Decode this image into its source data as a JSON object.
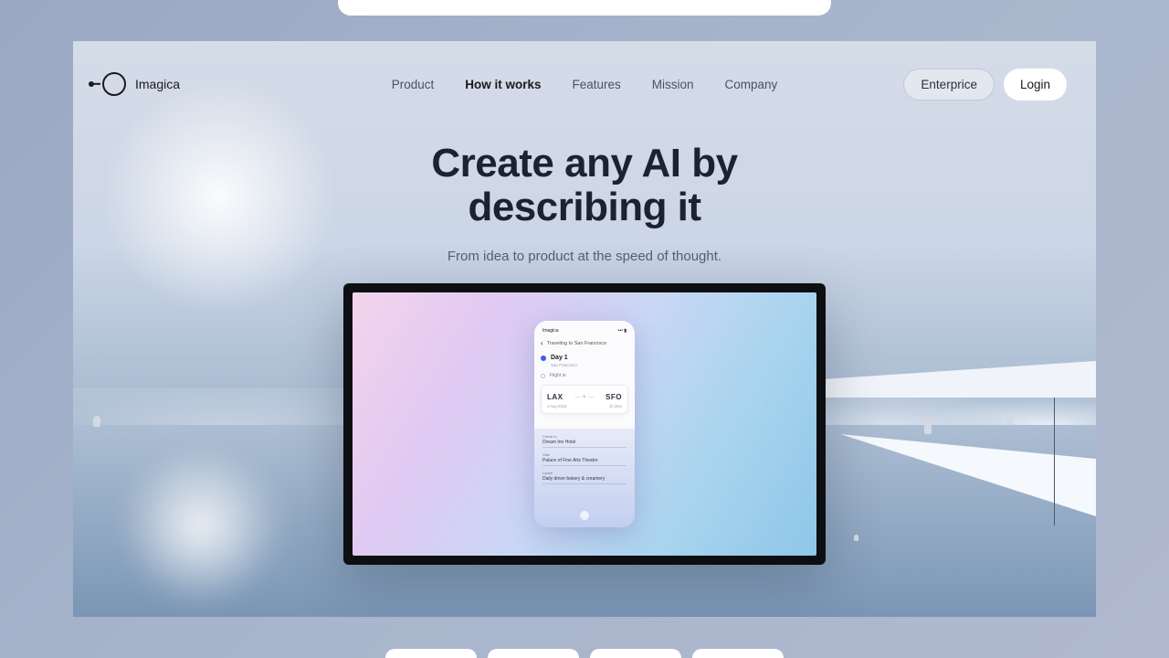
{
  "brand": {
    "name": "Imagica"
  },
  "nav": {
    "items": [
      {
        "label": "Product",
        "active": false
      },
      {
        "label": "How it works",
        "active": true
      },
      {
        "label": "Features",
        "active": false
      },
      {
        "label": "Mission",
        "active": false
      },
      {
        "label": "Company",
        "active": false
      }
    ]
  },
  "header_actions": {
    "enterprise_label": "Enterprice",
    "login_label": "Login"
  },
  "hero": {
    "title_line1": "Create any AI by",
    "title_line2": "describing it",
    "subtitle": "From idea to product at the speed of thought."
  },
  "phone": {
    "status_left": "Imagica",
    "breadcrumb": "Traveling to San Francisco",
    "day_label": "Day 1",
    "day_sub": "San Francisco",
    "flight": {
      "header": "Flight in",
      "from": "LAX",
      "to": "SFO",
      "date": "4 Aug 2023",
      "duration": "1h 25m"
    },
    "lower": [
      {
        "label": "Check in",
        "text": "Dream Inn Hotel"
      },
      {
        "label": "Visit",
        "text": "Palace of Fine Arts Theatre"
      },
      {
        "label": "Lunch",
        "text": "Daily driver bakery & creamery"
      }
    ]
  }
}
